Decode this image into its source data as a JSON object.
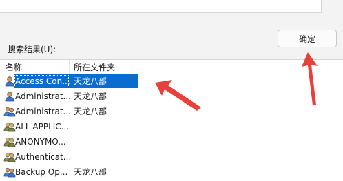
{
  "dialog": {
    "ok_label": "确定",
    "results_label": "搜索结果(U):"
  },
  "results": {
    "columns": {
      "name": "名称",
      "folder": "所在文件夹"
    },
    "rows": [
      {
        "name": "Access Con...",
        "folder": "天龙八部",
        "selected": true,
        "icon": "user-icon"
      },
      {
        "name": "Administrat...",
        "folder": "天龙八部",
        "selected": false,
        "icon": "user-icon"
      },
      {
        "name": "Administrat...",
        "folder": "天龙八部",
        "selected": false,
        "icon": "group-icon"
      },
      {
        "name": "ALL APPLIC...",
        "folder": "",
        "selected": false,
        "icon": "group-icon"
      },
      {
        "name": "ANONYMO...",
        "folder": "",
        "selected": false,
        "icon": "group-icon"
      },
      {
        "name": "Authenticat...",
        "folder": "",
        "selected": false,
        "icon": "group-icon"
      },
      {
        "name": "Backup Op...",
        "folder": "天龙八部",
        "selected": false,
        "icon": "group-icon"
      }
    ]
  },
  "colors": {
    "accent": "#0a6cce",
    "annotation_arrow": "#e8403a"
  }
}
